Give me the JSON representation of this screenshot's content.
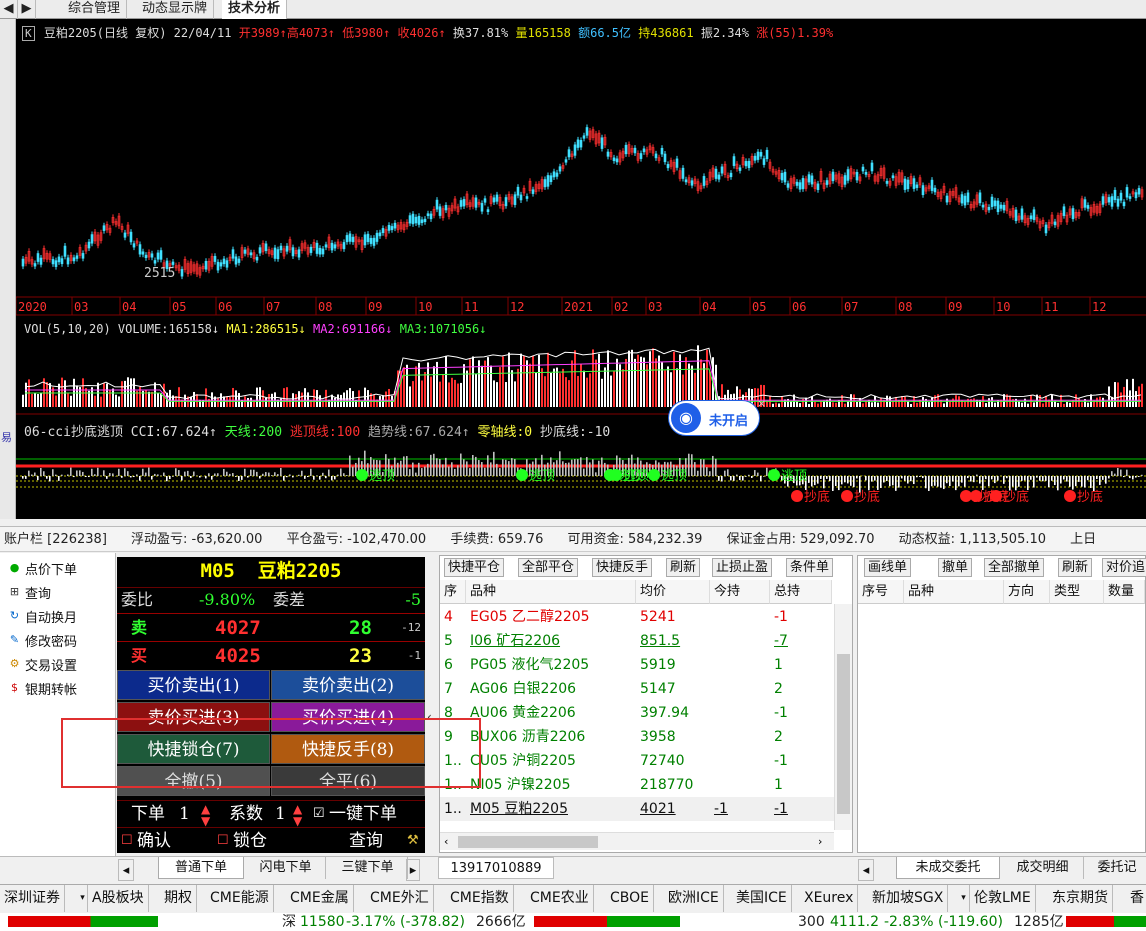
{
  "tabs": [
    "综合管理",
    "动态显示牌",
    "技术分析"
  ],
  "chart_header": {
    "badge": "K",
    "title": "豆粕2205(日线 复权) 22/04/11",
    "open": "开3989↑",
    "high": "高4073↑",
    "low": "低3980↑",
    "close": "收4026↑",
    "turnover": "换37.81%",
    "volume": "量165158",
    "amount": "额66.5亿",
    "hold": "持436861",
    "amplitude": "振2.34%",
    "change": "涨(55)1.39%"
  },
  "chart_low_label": "2515",
  "timeline": [
    "2020",
    "03",
    "04",
    "05",
    "06",
    "07",
    "08",
    "09",
    "10",
    "11",
    "12",
    "2021",
    "02",
    "03",
    "04",
    "05",
    "06",
    "07",
    "08",
    "09",
    "10",
    "11",
    "12"
  ],
  "vol_header": {
    "label": "VOL(5,10,20) VOLUME:165158↓",
    "ma1": "MA1:286515↓",
    "ma2": "MA2:691166↓",
    "ma3": "MA3:1071056↓"
  },
  "cci_header": {
    "label": "06-cci抄底逃顶 CCI:67.624↑",
    "sky": "天线:200",
    "escape": "逃顶线:100",
    "trend": "趋势线:67.624↑",
    "zero": "零轴线:0",
    "bottom": "抄底线:-10"
  },
  "signal_escape": "逃顶",
  "signal_bottom": "抄底",
  "popup_label": "未开启",
  "account": {
    "id": "账户栏 [226238]",
    "float_pl": "浮动盈亏: -63,620.00",
    "close_pl": "平仓盈亏: -102,470.00",
    "fee": "手续费: 659.76",
    "available": "可用资金: 584,232.39",
    "margin": "保证金占用: 529,092.70",
    "equity": "动态权益: 1,113,505.10",
    "more": "上日"
  },
  "left_menu": [
    {
      "icon": "●",
      "label": "点价下单"
    },
    {
      "icon": "⊞",
      "label": "查询"
    },
    {
      "icon": "↻",
      "label": "自动换月"
    },
    {
      "icon": "✎",
      "label": "修改密码"
    },
    {
      "icon": "⚙",
      "label": "交易设置"
    },
    {
      "icon": "$",
      "label": "银期转帐"
    }
  ],
  "quote": {
    "code": "M05",
    "name": "豆粕2205",
    "weibi_label": "委比",
    "weibi_value": "-9.80%",
    "weicha_label": "委差",
    "weicha_value": "-5",
    "sell_label": "卖",
    "sell_price": "4027",
    "sell_qty": "28",
    "sell_delta": "-12",
    "buy_label": "买",
    "buy_price": "4025",
    "buy_qty": "23",
    "buy_delta": "-1"
  },
  "order_buttons": [
    "买价卖出(1)",
    "卖价卖出(2)",
    "卖价买进(3)",
    "买价买进(4)",
    "快捷锁仓(7)",
    "快捷反手(8)",
    "全撤(5)",
    "全平(6)"
  ],
  "order_controls": {
    "lots_label": "下单",
    "lots_value": "1",
    "mult_label": "系数",
    "mult_value": "1",
    "oneclick": "一键下单",
    "confirm": "确认",
    "lock": "锁仓",
    "query": "查询"
  },
  "pos_toolbar": [
    "快捷平仓",
    "全部平仓",
    "快捷反手",
    "刷新",
    "止损止盈",
    "条件单"
  ],
  "pos_columns": [
    "序",
    "品种",
    "均价",
    "今持",
    "总持"
  ],
  "positions": [
    {
      "no": "4",
      "name": "EG05 乙二醇2205",
      "avg": "5241",
      "today": "",
      "total": "-1",
      "color": "#e00000"
    },
    {
      "no": "5",
      "name": "I06 矿石2206",
      "avg": "851.5",
      "today": "",
      "total": "-7",
      "color": "#008000"
    },
    {
      "no": "6",
      "name": "PG05 液化气2205",
      "avg": "5919",
      "today": "",
      "total": "1",
      "color": "#008000"
    },
    {
      "no": "7",
      "name": "AG06 白银2206",
      "avg": "5147",
      "today": "",
      "total": "2",
      "color": "#008000"
    },
    {
      "no": "8",
      "name": "AU06 黄金2206",
      "avg": "397.94",
      "today": "",
      "total": "-1",
      "color": "#008000"
    },
    {
      "no": "9",
      "name": "BUX06 沥青2206",
      "avg": "3958",
      "today": "",
      "total": "2",
      "color": "#008000"
    },
    {
      "no": "1..",
      "name": "CU05 沪铜2205",
      "avg": "72740",
      "today": "",
      "total": "-1",
      "color": "#008000"
    },
    {
      "no": "1..",
      "name": "NI05 沪镍2205",
      "avg": "218770",
      "today": "",
      "total": "1",
      "color": "#008000"
    },
    {
      "no": "1..",
      "name": "M05 豆粕2205",
      "avg": "4021",
      "today": "-1",
      "total": "-1",
      "color": "#111111"
    }
  ],
  "orders_toolbar": [
    "画线单",
    "撤单",
    "全部撤单",
    "刷新",
    "对价追"
  ],
  "order_columns": [
    "序号",
    "品种",
    "方向",
    "类型",
    "数量"
  ],
  "bottom_tabs_left": [
    "普通下单",
    "闪电下单",
    "三键下单"
  ],
  "account_number": "13917010889",
  "bottom_tabs_right": [
    "未成交委托",
    "成交明细",
    "委托记"
  ],
  "markets": [
    "深圳证券",
    "A股板块",
    "期权",
    "CME能源",
    "CME金属",
    "CME外汇",
    "CME指数",
    "CME农业",
    "CBOE",
    "欧洲ICE",
    "美国ICE",
    "XEurex",
    "新加坡SGX",
    "伦敦LME",
    "东京期货",
    "香"
  ],
  "ticker": {
    "sz_name": "深",
    "sz_value": "11580",
    "sz_change": "-3.17% (-378.82)",
    "sz_amount": "2666亿",
    "idx_name": "300",
    "idx_value": "4111.2",
    "idx_change": "-2.83% (-119.60)",
    "idx_amount": "1285亿"
  }
}
